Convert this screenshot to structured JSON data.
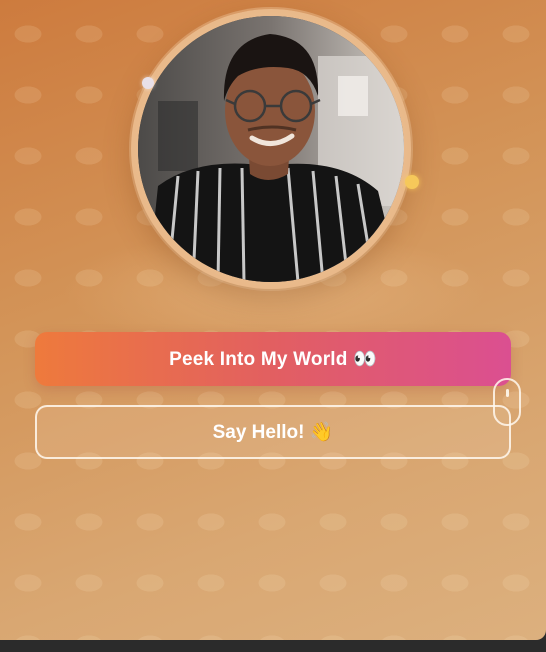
{
  "profile": {
    "photo_icon": "profile-photo"
  },
  "actions": {
    "primary_label": "Peek Into My World 👀",
    "secondary_label": "Say Hello! 👋"
  },
  "decor": {
    "scroll_icon": "mouse-scroll-icon",
    "accent_color": "#e25f61",
    "gradient_start": "#ee7a3c",
    "gradient_end": "#db4f91",
    "dot_color": "#f6c85a"
  }
}
